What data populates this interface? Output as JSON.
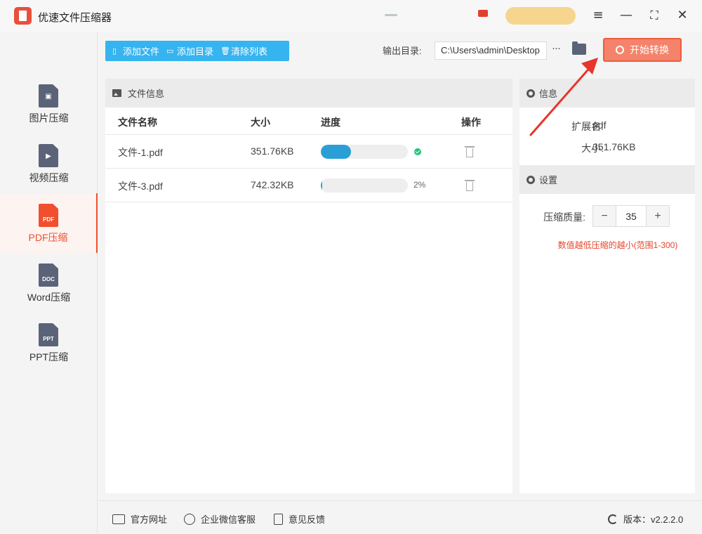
{
  "app": {
    "title": "优速文件压缩器"
  },
  "window_controls": [
    "menu-icon",
    "minimize-icon",
    "maximize-icon",
    "close-icon"
  ],
  "sidebar": {
    "items": [
      {
        "label": "图片压缩",
        "tag": "",
        "icon": "image-file-icon",
        "active": false
      },
      {
        "label": "视频压缩",
        "tag": "",
        "icon": "video-file-icon",
        "active": false
      },
      {
        "label": "PDF压缩",
        "tag": "PDF",
        "icon": "pdf-file-icon",
        "active": true
      },
      {
        "label": "Word压缩",
        "tag": "DOC",
        "icon": "doc-file-icon",
        "active": false
      },
      {
        "label": "PPT压缩",
        "tag": "PPT",
        "icon": "ppt-file-icon",
        "active": false
      }
    ]
  },
  "toolbar": {
    "add_file": "添加文件",
    "add_folder": "添加目录",
    "clear_list": "清除列表",
    "output_label": "输出目录:",
    "output_path": "C:\\Users\\admin\\Desktop",
    "more": "···",
    "start": "开始转换",
    "accent_color": "#36b4ef",
    "start_color": "#f4836b"
  },
  "file_panel": {
    "title": "文件信息",
    "columns": {
      "name": "文件名称",
      "size": "大小",
      "progress": "进度",
      "action": "操作"
    },
    "rows": [
      {
        "name": "文件-1.pdf",
        "size": "351.76KB",
        "progress": 0.35,
        "status": "done",
        "percent_text": ""
      },
      {
        "name": "文件-3.pdf",
        "size": "742.32KB",
        "progress": 0.02,
        "status": "running",
        "percent_text": "2%"
      }
    ]
  },
  "info_panel": {
    "info_title": "信息",
    "ext_label": "扩展名:",
    "ext_value": "pdf",
    "size_label": "大小:",
    "size_value": "351.76KB",
    "settings_title": "设置",
    "quality_label": "压缩质量:",
    "quality_value": "35",
    "minus": "−",
    "plus": "+",
    "hint": "数值越低压缩的越小(范围1-300)",
    "hint_color": "#e5462a"
  },
  "footer": {
    "website": "官方网址",
    "wechat": "企业微信客服",
    "feedback": "意见反馈",
    "version": "版本：v2.2.2.0"
  }
}
